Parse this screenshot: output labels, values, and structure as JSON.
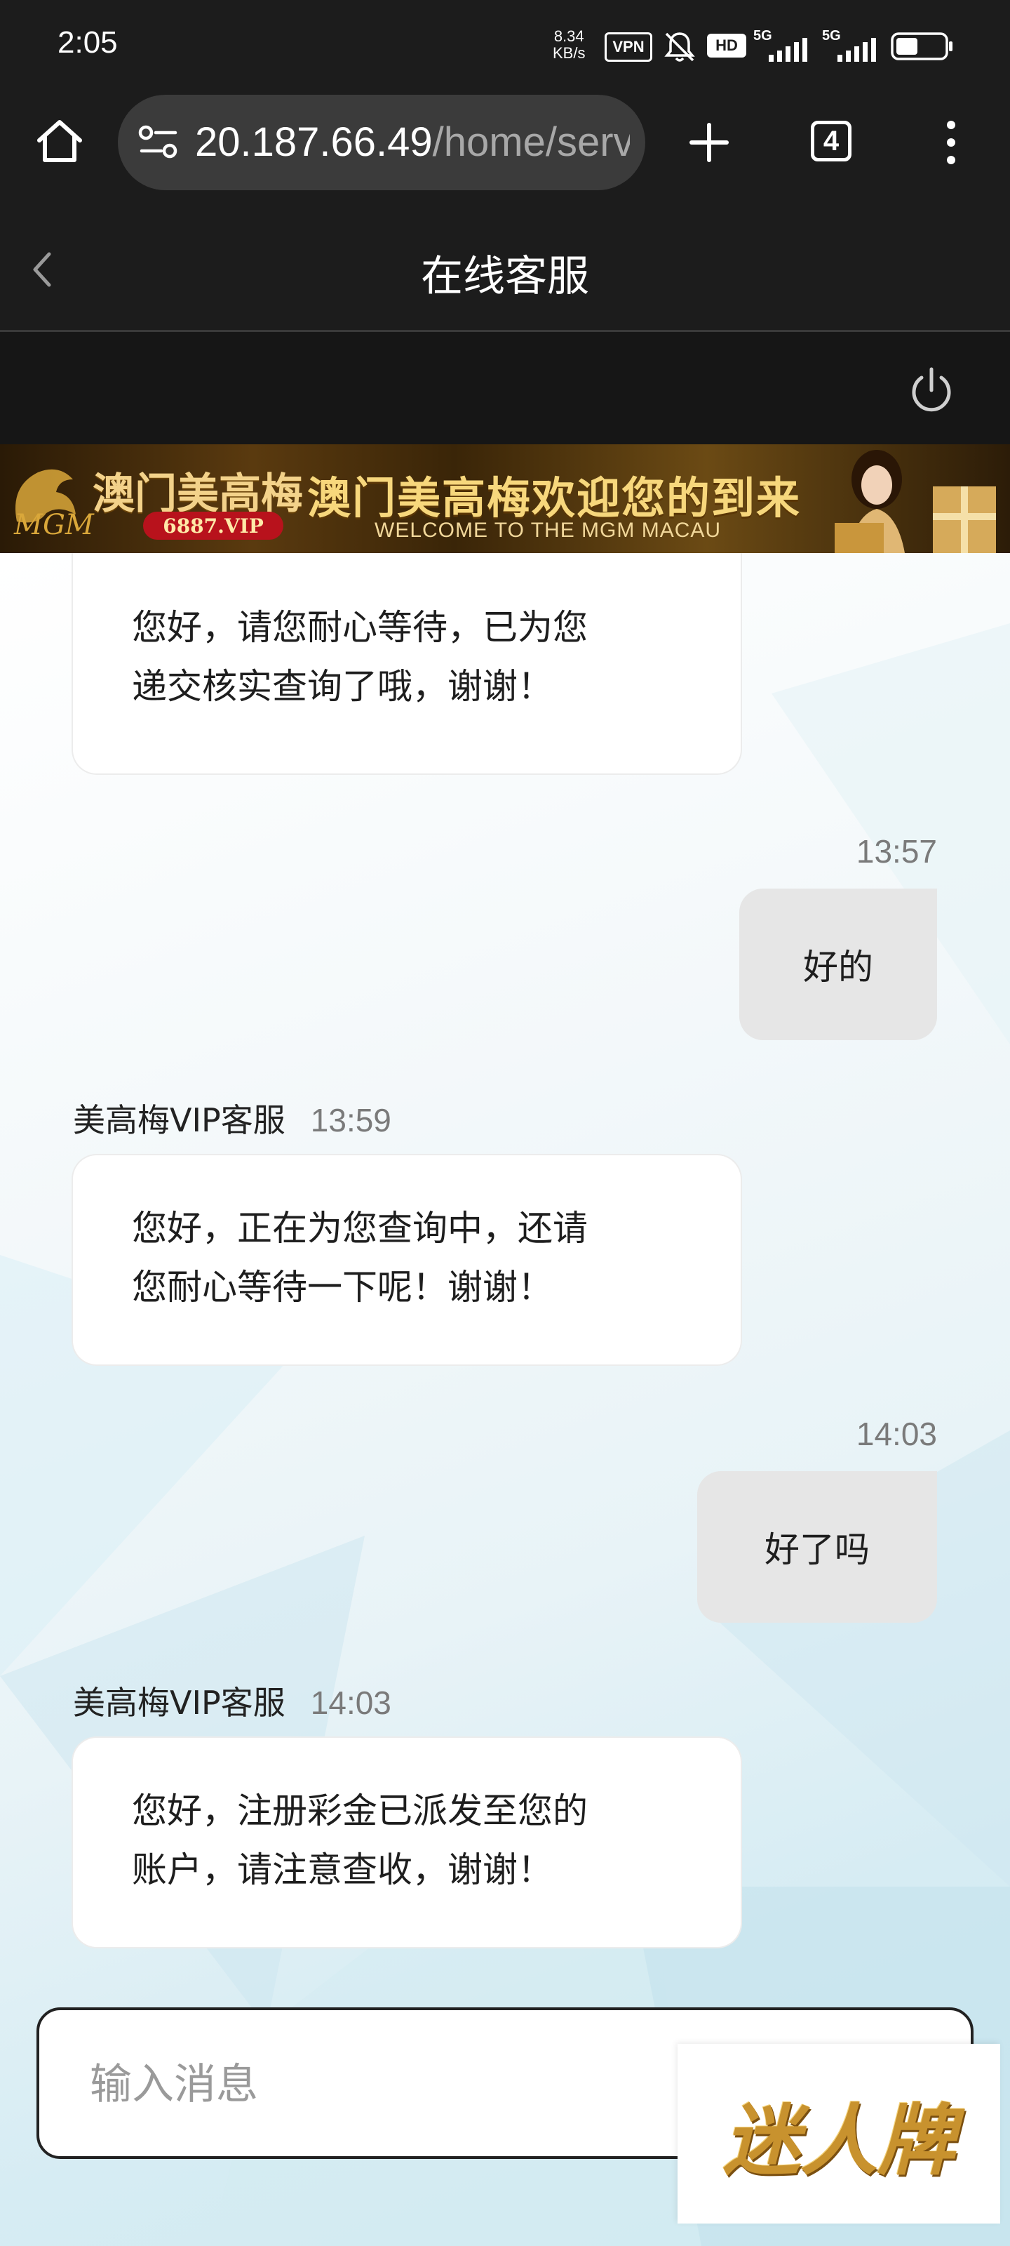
{
  "status_bar": {
    "time": "2:05",
    "net_speed_value": "8.34",
    "net_speed_unit": "KB/s",
    "vpn": "VPN",
    "hd": "HD",
    "signal1": "5G",
    "signal2": "5G",
    "battery_level": 0.45
  },
  "browser": {
    "url_host": "20.187.66.49",
    "url_path": "/home/serv",
    "tab_count": "4",
    "icons": [
      "home-icon",
      "site-settings-icon",
      "new-tab-icon",
      "tabs-icon",
      "more-menu-icon"
    ]
  },
  "header": {
    "title": "在线客服",
    "back_icon": "chevron-left-icon"
  },
  "chat_toolbar": {
    "power_icon": "power-icon"
  },
  "banner": {
    "brand_cn": "澳门美高梅",
    "brand_logo": "MGM",
    "site": "6887.VIP",
    "headline": "澳门美高梅欢迎您的到来",
    "subline": "WELCOME TO THE MGM MACAU"
  },
  "messages": [
    {
      "dir": "in",
      "text_line1": "您好，请您耐心等待，已为您",
      "text_line2": "递交核实查询了哦，谢谢！"
    },
    {
      "dir": "out",
      "time": "13:57",
      "text": "好的"
    },
    {
      "dir": "in",
      "sender": "美高梅VIP客服",
      "time": "13:59",
      "text_line1": "您好，正在为您查询中，还请",
      "text_line2": "您耐心等待一下呢！谢谢！"
    },
    {
      "dir": "out",
      "time": "14:03",
      "text": "好了吗"
    },
    {
      "dir": "in",
      "sender": "美高梅VIP客服",
      "time": "14:03",
      "text_line1": "您好，注册彩金已派发至您的",
      "text_line2": "账户，请注意查收，谢谢！"
    }
  ],
  "input": {
    "placeholder": "输入消息"
  },
  "watermark": {
    "text": "迷人牌"
  },
  "colors": {
    "dark_bg": "#1c1c1c",
    "out_bubble": "#e6e6e6",
    "in_bubble": "#ffffff",
    "gold": "#d9a73a"
  }
}
